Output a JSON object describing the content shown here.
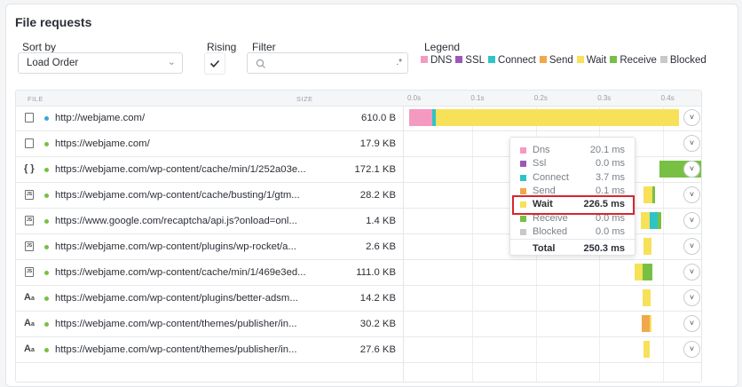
{
  "panel": {
    "title": "File requests"
  },
  "controls": {
    "sort_label": "Sort by",
    "sort_value": "Load Order",
    "rising_label": "Rising",
    "rising_checked": true,
    "filter_label": "Filter",
    "filter_value": "",
    "filter_regex": ".*",
    "legend_label": "Legend"
  },
  "legend": [
    {
      "name": "DNS",
      "color": "#f49ac1"
    },
    {
      "name": "SSL",
      "color": "#9b59b6"
    },
    {
      "name": "Connect",
      "color": "#2ec4c6"
    },
    {
      "name": "Send",
      "color": "#f0a94a"
    },
    {
      "name": "Wait",
      "color": "#f7e159"
    },
    {
      "name": "Receive",
      "color": "#78c043"
    },
    {
      "name": "Blocked",
      "color": "#c8c8c8"
    }
  ],
  "table": {
    "col_file": "File",
    "col_size": "Size",
    "ticks": [
      "0.0s",
      "0.1s",
      "0.2s",
      "0.3s",
      "0.4s"
    ],
    "rows": [
      {
        "icon": "file-icon",
        "dot": "#3aa3e3",
        "url": "http://webjame.com/",
        "size": "610.0 B",
        "timing": [
          {
            "phase": "DNS",
            "start": 0,
            "ms": 36.5
          },
          {
            "phase": "Connect",
            "start": 36.5,
            "ms": 6.0
          },
          {
            "phase": "Wait",
            "start": 42.5,
            "ms": 383
          }
        ]
      },
      {
        "icon": "file-icon",
        "dot": "#78c043",
        "url": "https://webjame.com/",
        "size": "17.9 KB",
        "timing": []
      },
      {
        "icon": "json-icon",
        "dot": "#78c043",
        "url": "https://webjame.com/wp-content/cache/min/1/252a03e...",
        "size": "172.1 KB",
        "timing": [
          {
            "phase": "Receive",
            "start": 395,
            "ms": 70
          }
        ]
      },
      {
        "icon": "js-file-icon",
        "dot": "#78c043",
        "url": "https://webjame.com/wp-content/cache/busting/1/gtm...",
        "size": "28.2 KB",
        "timing": [
          {
            "phase": "Wait",
            "start": 370,
            "ms": 14
          },
          {
            "phase": "Receive",
            "start": 384,
            "ms": 4
          }
        ]
      },
      {
        "icon": "js-file-icon",
        "dot": "#78c043",
        "url": "https://www.google.com/recaptcha/api.js?onload=onl...",
        "size": "1.4 KB",
        "timing": [
          {
            "phase": "Wait",
            "start": 366,
            "ms": 14
          },
          {
            "phase": "Connect",
            "start": 380,
            "ms": 12
          },
          {
            "phase": "Receive",
            "start": 392,
            "ms": 6
          }
        ]
      },
      {
        "icon": "js-file-icon",
        "dot": "#78c043",
        "url": "https://webjame.com/wp-content/plugins/wp-rocket/a...",
        "size": "2.6 KB",
        "timing": [
          {
            "phase": "Wait",
            "start": 370,
            "ms": 12
          }
        ]
      },
      {
        "icon": "js-file-icon",
        "dot": "#78c043",
        "url": "https://webjame.com/wp-content/cache/min/1/469e3ed...",
        "size": "111.0 KB",
        "timing": [
          {
            "phase": "Wait",
            "start": 356,
            "ms": 12
          },
          {
            "phase": "Receive",
            "start": 368,
            "ms": 16
          }
        ]
      },
      {
        "icon": "font-icon",
        "dot": "#78c043",
        "url": "https://webjame.com/wp-content/plugins/better-adsm...",
        "size": "14.2 KB",
        "timing": [
          {
            "phase": "Wait",
            "start": 368,
            "ms": 13
          }
        ]
      },
      {
        "icon": "font-icon",
        "dot": "#78c043",
        "url": "https://webjame.com/wp-content/themes/publisher/in...",
        "size": "30.2 KB",
        "timing": [
          {
            "phase": "Send",
            "start": 367,
            "ms": 12
          },
          {
            "phase": "Wait",
            "start": 379,
            "ms": 3
          }
        ]
      },
      {
        "icon": "font-icon",
        "dot": "#78c043",
        "url": "https://webjame.com/wp-content/themes/publisher/in...",
        "size": "27.6 KB",
        "timing": [
          {
            "phase": "Wait",
            "start": 370,
            "ms": 10
          }
        ]
      }
    ]
  },
  "tooltip": {
    "rows": [
      {
        "name": "Dns",
        "value": "20.1 ms",
        "color": "#f49ac1"
      },
      {
        "name": "Ssl",
        "value": "0.0 ms",
        "color": "#9b59b6"
      },
      {
        "name": "Connect",
        "value": "3.7 ms",
        "color": "#2ec4c6"
      },
      {
        "name": "Send",
        "value": "0.1 ms",
        "color": "#f0a94a"
      },
      {
        "name": "Wait",
        "value": "226.5 ms",
        "color": "#f7e159",
        "highlight": true
      },
      {
        "name": "Receive",
        "value": "0.0 ms",
        "color": "#78c043"
      },
      {
        "name": "Blocked",
        "value": "0.0 ms",
        "color": "#c8c8c8"
      }
    ],
    "total_label": "Total",
    "total_value": "250.3 ms"
  }
}
